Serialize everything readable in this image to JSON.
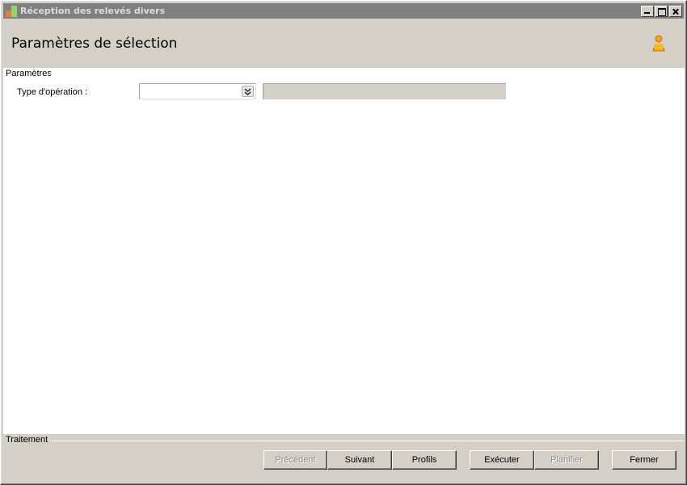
{
  "window": {
    "title": "Réception des relevés divers"
  },
  "header": {
    "title": "Paramètres de sélection",
    "user_icon": "user-icon"
  },
  "params": {
    "group_label": "Paramètres",
    "type_operation": {
      "label": "Type d'opération :",
      "value": "",
      "description": ""
    }
  },
  "traitement": {
    "group_label": "Traitement",
    "buttons": {
      "precedent": "Précédent",
      "suivant": "Suivant",
      "profils": "Profils",
      "executer": "Exécuter",
      "planifier": "Planifier",
      "fermer": "Fermer"
    }
  },
  "colors": {
    "titlebar": "#808080",
    "face": "#d4d0c8",
    "panel": "#ffffff",
    "user_icon": "#f2a51c"
  }
}
